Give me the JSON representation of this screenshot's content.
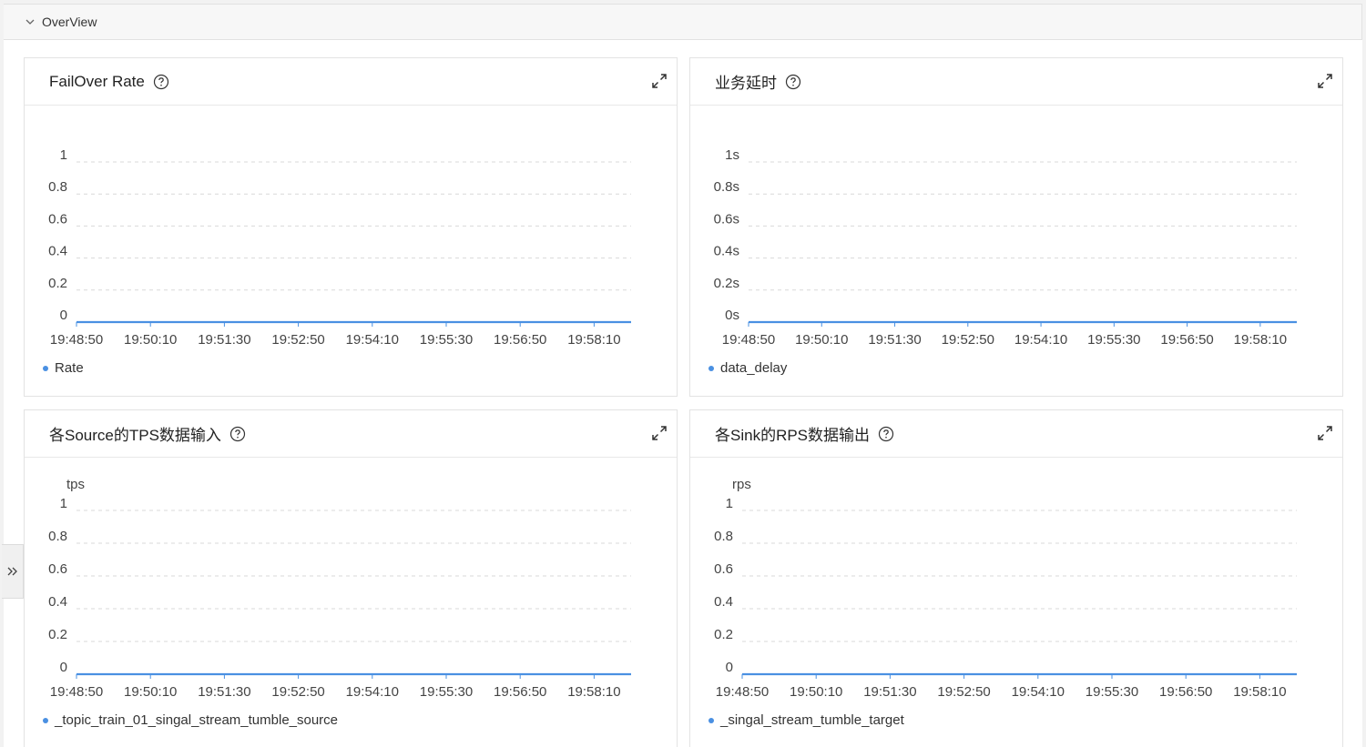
{
  "section": {
    "title": "OverView"
  },
  "colors": {
    "series": "#4a90e2",
    "grid": "#d9d9d9",
    "axis_text": "#444"
  },
  "panels": [
    {
      "title": "FailOver Rate",
      "chart_data": {
        "type": "line",
        "title": "FailOver Rate",
        "unit_label": "",
        "y_tick_labels": [
          "0",
          "0.2",
          "0.4",
          "0.6",
          "0.8",
          "1"
        ],
        "ylim": [
          0,
          1
        ],
        "x_tick_labels": [
          "19:48:50",
          "19:50:10",
          "19:51:30",
          "19:52:50",
          "19:54:10",
          "19:55:30",
          "19:56:50",
          "19:58:10"
        ],
        "grid": true,
        "legend_position": "bottom-left",
        "series": [
          {
            "name": "Rate",
            "values": [
              0,
              0,
              0,
              0,
              0,
              0,
              0,
              0
            ]
          }
        ]
      }
    },
    {
      "title": "业务延时",
      "chart_data": {
        "type": "line",
        "title": "业务延时",
        "unit_label": "",
        "y_tick_labels": [
          "0s",
          "0.2s",
          "0.4s",
          "0.6s",
          "0.8s",
          "1s"
        ],
        "ylim": [
          0,
          1
        ],
        "x_tick_labels": [
          "19:48:50",
          "19:50:10",
          "19:51:30",
          "19:52:50",
          "19:54:10",
          "19:55:30",
          "19:56:50",
          "19:58:10"
        ],
        "grid": true,
        "legend_position": "bottom-left",
        "series": [
          {
            "name": "data_delay",
            "values": [
              0,
              0,
              0,
              0,
              0,
              0,
              0,
              0
            ]
          }
        ]
      }
    },
    {
      "title": "各Source的TPS数据输入",
      "chart_data": {
        "type": "line",
        "title": "各Source的TPS数据输入",
        "unit_label": "tps",
        "y_tick_labels": [
          "0",
          "0.2",
          "0.4",
          "0.6",
          "0.8",
          "1"
        ],
        "ylim": [
          0,
          1
        ],
        "x_tick_labels": [
          "19:48:50",
          "19:50:10",
          "19:51:30",
          "19:52:50",
          "19:54:10",
          "19:55:30",
          "19:56:50",
          "19:58:10"
        ],
        "grid": true,
        "legend_position": "bottom-left",
        "series": [
          {
            "name": "_topic_train_01_singal_stream_tumble_source",
            "values": [
              0,
              0,
              0,
              0,
              0,
              0,
              0,
              0
            ]
          }
        ]
      }
    },
    {
      "title": "各Sink的RPS数据输出",
      "chart_data": {
        "type": "line",
        "title": "各Sink的RPS数据输出",
        "unit_label": "rps",
        "y_tick_labels": [
          "0",
          "0.2",
          "0.4",
          "0.6",
          "0.8",
          "1"
        ],
        "ylim": [
          0,
          1
        ],
        "x_tick_labels": [
          "19:48:50",
          "19:50:10",
          "19:51:30",
          "19:52:50",
          "19:54:10",
          "19:55:30",
          "19:56:50",
          "19:58:10"
        ],
        "grid": true,
        "legend_position": "bottom-left",
        "series": [
          {
            "name": "_singal_stream_tumble_target",
            "values": [
              0,
              0,
              0,
              0,
              0,
              0,
              0,
              0
            ]
          }
        ]
      }
    }
  ]
}
